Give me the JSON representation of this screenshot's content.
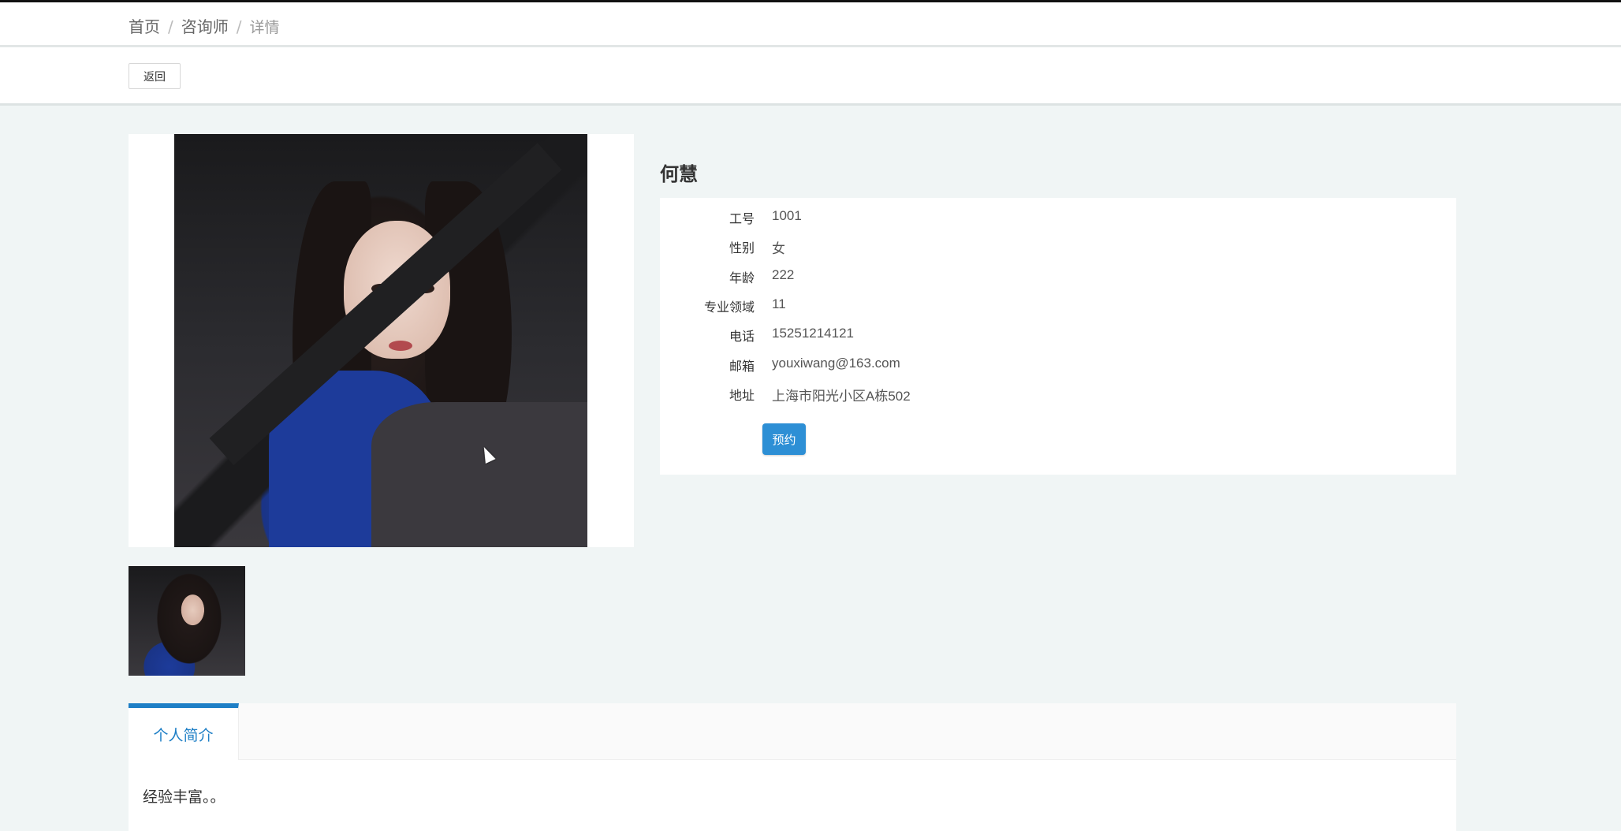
{
  "breadcrumb": {
    "home": "首页",
    "section": "咨询师",
    "current": "详情",
    "separator": "/"
  },
  "toolbar": {
    "back_label": "返回"
  },
  "consultant": {
    "name": "何慧",
    "fields": [
      {
        "label": "工号",
        "value": "1001"
      },
      {
        "label": "性别",
        "value": "女"
      },
      {
        "label": "年龄",
        "value": "222"
      },
      {
        "label": "专业领域",
        "value": "11"
      },
      {
        "label": "电话",
        "value": "15251214121"
      },
      {
        "label": "邮箱",
        "value": "youxiwang@163.com"
      },
      {
        "label": "地址",
        "value": "上海市阳光小区A栋502"
      }
    ],
    "reserve_label": "预约"
  },
  "tabs": [
    {
      "label": "个人简介",
      "active": true
    }
  ],
  "intro": {
    "text": "经验丰富。。"
  },
  "colors": {
    "accent": "#2d8fd5",
    "tab_active": "#1e7fc6",
    "background": "#f0f5f5"
  },
  "icons": {
    "cursor": "mouse-cursor-icon"
  }
}
